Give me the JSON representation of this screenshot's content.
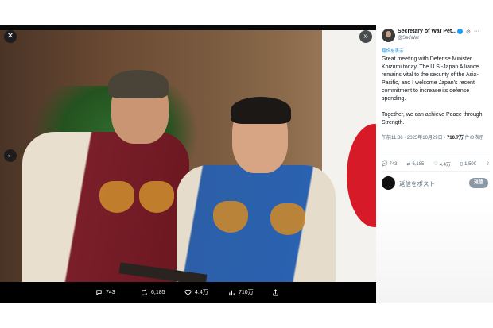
{
  "post": {
    "display_name": "Secretary of War Pet...",
    "handle": "@SecWar",
    "translate_label": "翻訳を表示",
    "paragraphs": [
      "Great meeting with Defense Minister Koizumi today. The U.S.-Japan Alliance remains vital to the security of the Asia-Pacific, and I welcome Japan's recent commitment to increase its defense spending.",
      "Together, we can achieve Peace through Strength."
    ],
    "time": "午前11:36 · 2025年10月29日 · ",
    "views_count": "710.7万",
    "views_label": " 件の表示",
    "stats": {
      "replies": "743",
      "reposts": "6,185",
      "likes": "4.4万",
      "views": "1,500"
    },
    "reply_placeholder": "返信をポスト",
    "reply_button": "返信"
  },
  "viewer": {
    "action_stats": {
      "replies": "743",
      "reposts": "6,185",
      "likes": "4.4万",
      "views": "710万"
    }
  },
  "colors": {
    "accent": "#1d9bf0",
    "viewer_bg": "#000000",
    "flag_red": "#d71a28"
  },
  "icons": [
    "close-icon",
    "expand-icon",
    "prev-arrow-icon",
    "reply-icon",
    "repost-icon",
    "like-icon",
    "views-icon",
    "share-icon",
    "verified-icon",
    "grok-icon",
    "more-icon"
  ]
}
